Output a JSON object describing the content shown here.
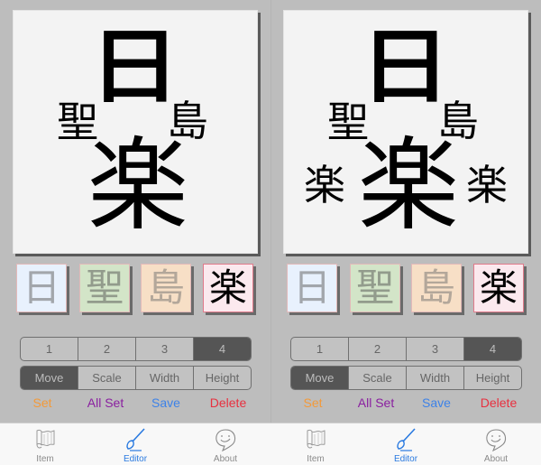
{
  "panels": [
    {
      "canvas": {
        "glyphs": {
          "top": "日",
          "left": "聖",
          "right": "島",
          "center": "楽",
          "extra_left": "",
          "extra_right": ""
        }
      },
      "tiles": [
        "日",
        "聖",
        "島",
        "楽"
      ],
      "selected_tile": 3,
      "pages": [
        "1",
        "2",
        "3",
        "4"
      ],
      "selected_page": "4",
      "modes": [
        "Move",
        "Scale",
        "Width",
        "Height"
      ],
      "selected_mode": "Move",
      "actions": {
        "set": "Set",
        "all_set": "All Set",
        "save": "Save",
        "delete": "Delete"
      },
      "tabbar": {
        "item": "Item",
        "editor": "Editor",
        "about": "About",
        "selected": "Editor"
      }
    },
    {
      "canvas": {
        "glyphs": {
          "top": "日",
          "left": "聖",
          "right": "島",
          "center": "楽",
          "extra_left": "楽",
          "extra_right": "楽"
        }
      },
      "tiles": [
        "日",
        "聖",
        "島",
        "楽"
      ],
      "selected_tile": 3,
      "pages": [
        "1",
        "2",
        "3",
        "4"
      ],
      "selected_page": "4",
      "modes": [
        "Move",
        "Scale",
        "Width",
        "Height"
      ],
      "selected_mode": "Move",
      "actions": {
        "set": "Set",
        "all_set": "All Set",
        "save": "Save",
        "delete": "Delete"
      },
      "tabbar": {
        "item": "Item",
        "editor": "Editor",
        "about": "About",
        "selected": "Editor"
      }
    }
  ],
  "colors": {
    "background": "#bdbdbd",
    "set": "#f39a3a",
    "all_set": "#8a1fa0",
    "save": "#3d82e8",
    "delete": "#e8303f",
    "tab_active": "#2a7ae0",
    "tile_colors": [
      "#e8f1fd",
      "#d3e5c8",
      "#f7dfc6",
      "#fbe9ee"
    ]
  }
}
